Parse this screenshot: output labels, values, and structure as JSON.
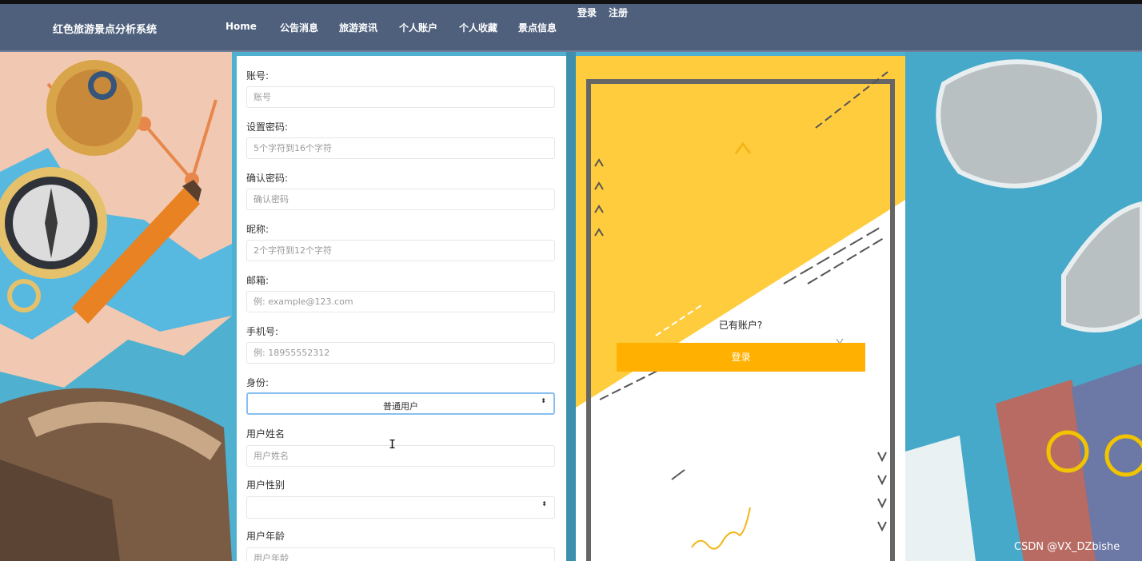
{
  "header": {
    "brand": "红色旅游景点分析系统",
    "nav": [
      "Home",
      "公告消息",
      "旅游资讯",
      "个人账户",
      "个人收藏",
      "景点信息"
    ],
    "login": "登录",
    "register": "注册"
  },
  "form": {
    "fields": [
      {
        "label": "账号:",
        "placeholder": "账号"
      },
      {
        "label": "设置密码:",
        "placeholder": "5个字符到16个字符"
      },
      {
        "label": "确认密码:",
        "placeholder": "确认密码"
      },
      {
        "label": "昵称:",
        "placeholder": "2个字符到12个字符"
      },
      {
        "label": "邮箱:",
        "placeholder": "例: example@123.com"
      },
      {
        "label": "手机号:",
        "placeholder": "例: 18955552312"
      }
    ],
    "identity": {
      "label": "身份:",
      "value": "普通用户"
    },
    "real_name": {
      "label": "用户姓名",
      "placeholder": "用户姓名"
    },
    "gender": {
      "label": "用户性别",
      "value": ""
    },
    "age": {
      "label": "用户年龄",
      "placeholder": "用户年龄"
    }
  },
  "card": {
    "have_account": "已有账户?",
    "login_button": "登录"
  },
  "icons": {
    "select_arrow": "⬍",
    "text_cursor": "I"
  },
  "colors": {
    "navbar": "#4e607c",
    "accent": "#ffb000",
    "card_yellow": "#ffcc3d"
  },
  "watermark": "CSDN @VX_DZbishe"
}
